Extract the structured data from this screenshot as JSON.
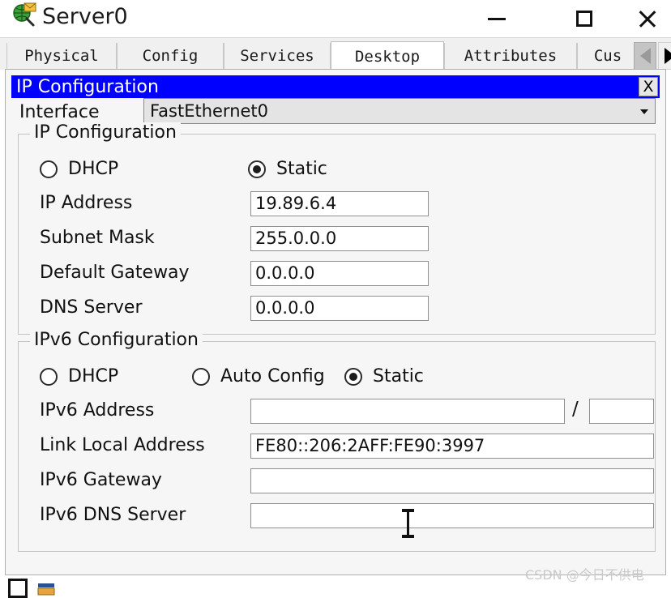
{
  "window": {
    "title": "Server0",
    "icon": "server-globe-icon",
    "controls": {
      "minimize": "minimize-icon",
      "maximize": "maximize-icon",
      "close": "close-icon"
    }
  },
  "tabs": {
    "items": [
      {
        "label": "Physical",
        "active": false
      },
      {
        "label": "Config",
        "active": false
      },
      {
        "label": "Services",
        "active": false
      },
      {
        "label": "Desktop",
        "active": true
      },
      {
        "label": "Attributes",
        "active": false
      },
      {
        "label": "Cus",
        "active": false
      }
    ],
    "scroll_left": "triangle-left-icon",
    "scroll_right": "triangle-right-icon"
  },
  "dialog": {
    "title": "IP Configuration",
    "close_label": "X",
    "titlebar_color": "#0000ff",
    "interface": {
      "label": "Interface",
      "value": "FastEthernet0"
    },
    "ipv4": {
      "legend": "IP Configuration",
      "modes": [
        {
          "label": "DHCP",
          "selected": false
        },
        {
          "label": "Static",
          "selected": true
        }
      ],
      "fields": [
        {
          "label": "IP Address",
          "value": "19.89.6.4",
          "placeholder": ""
        },
        {
          "label": "Subnet Mask",
          "value": "255.0.0.0",
          "placeholder": ""
        },
        {
          "label": "Default Gateway",
          "value": "0.0.0.0",
          "placeholder": ""
        },
        {
          "label": "DNS Server",
          "value": "0.0.0.0",
          "placeholder": ""
        }
      ]
    },
    "ipv6": {
      "legend": "IPv6 Configuration",
      "modes": [
        {
          "label": "DHCP",
          "selected": false
        },
        {
          "label": "Auto Config",
          "selected": false
        },
        {
          "label": "Static",
          "selected": true
        }
      ],
      "address_row": {
        "label": "IPv6 Address",
        "value": "",
        "separator": "/",
        "prefix_value": ""
      },
      "fields": [
        {
          "label": "Link Local Address",
          "value": "FE80::206:2AFF:FE90:3997",
          "placeholder": ""
        },
        {
          "label": "IPv6 Gateway",
          "value": "",
          "placeholder": ""
        },
        {
          "label": "IPv6 DNS Server",
          "value": "",
          "placeholder": ""
        }
      ]
    }
  },
  "watermark": {
    "text": "CSDN @今日不供电"
  }
}
